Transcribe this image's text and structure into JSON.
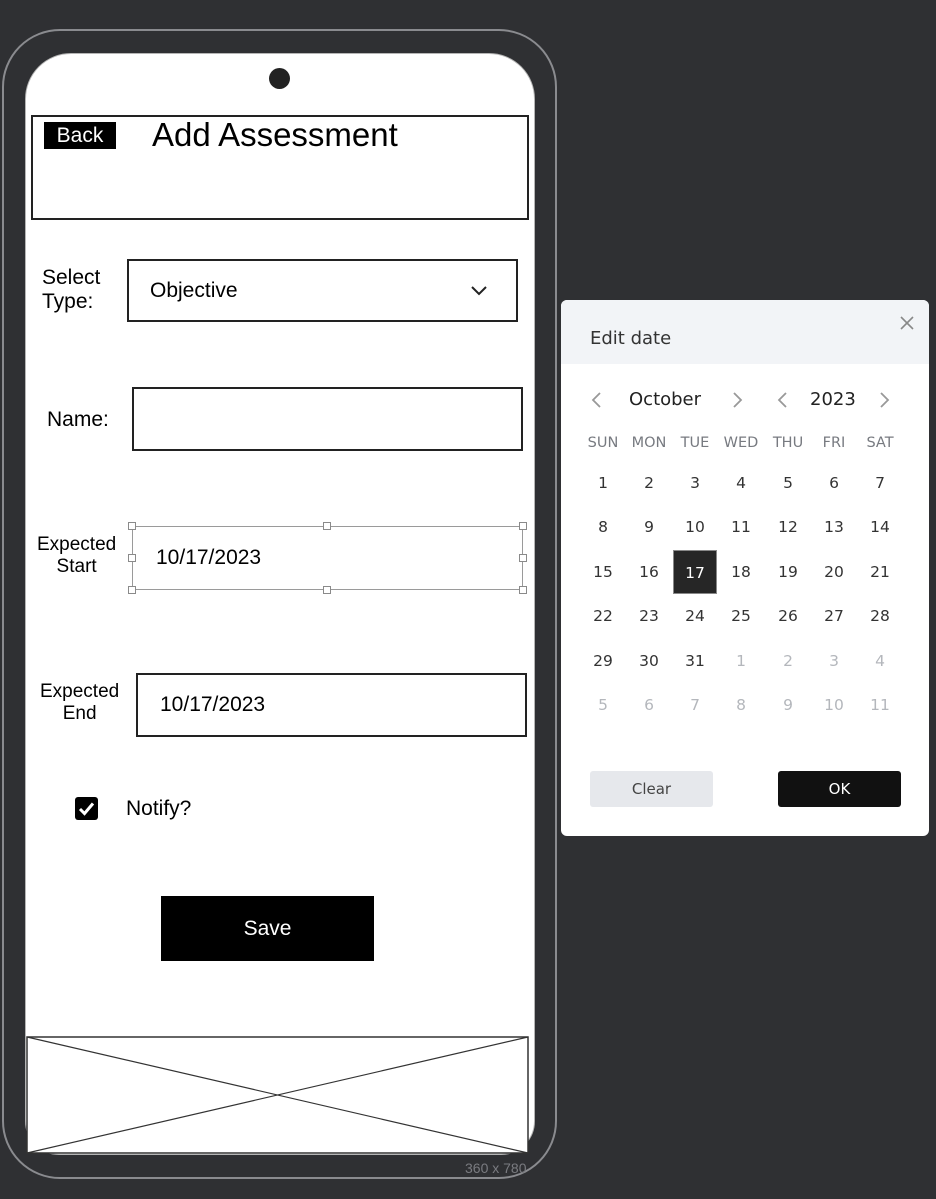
{
  "form": {
    "back_label": "Back",
    "title": "Add Assessment",
    "type_label_line1": "Select",
    "type_label_line2": "Type:",
    "type_value": "Objective",
    "name_label": "Name:",
    "name_value": "",
    "start_label_line1": "Expected",
    "start_label_line2": "Start",
    "start_value": "10/17/2023",
    "end_label_line1": "Expected",
    "end_label_line2": "End",
    "end_value": "10/17/2023",
    "notify_label": "Notify?",
    "notify_checked": true,
    "save_label": "Save"
  },
  "device": {
    "size_label": "360 x 780"
  },
  "date_dialog": {
    "title": "Edit date",
    "month": "October",
    "year": "2023",
    "weekdays": [
      "SUN",
      "MON",
      "TUE",
      "WED",
      "THU",
      "FRI",
      "SAT"
    ],
    "days": [
      [
        "1",
        "2",
        "3",
        "4",
        "5",
        "6",
        "7"
      ],
      [
        "8",
        "9",
        "10",
        "11",
        "12",
        "13",
        "14"
      ],
      [
        "15",
        "16",
        "17",
        "18",
        "19",
        "20",
        "21"
      ],
      [
        "22",
        "23",
        "24",
        "25",
        "26",
        "27",
        "28"
      ],
      [
        "29",
        "30",
        "31",
        "1",
        "2",
        "3",
        "4"
      ],
      [
        "5",
        "6",
        "7",
        "8",
        "9",
        "10",
        "11"
      ]
    ],
    "selected_day": "17",
    "clear_label": "Clear",
    "ok_label": "OK"
  },
  "icons": {
    "dropdown": "chevron-down-icon",
    "close": "close-icon",
    "checkbox": "checkmark-icon",
    "prev": "chevron-left-icon",
    "next": "chevron-right-icon",
    "image_placeholder": "image-placeholder-icon"
  },
  "colors": {
    "canvas": "#2f3033",
    "selected_day": "#262626",
    "button": "#000000"
  }
}
